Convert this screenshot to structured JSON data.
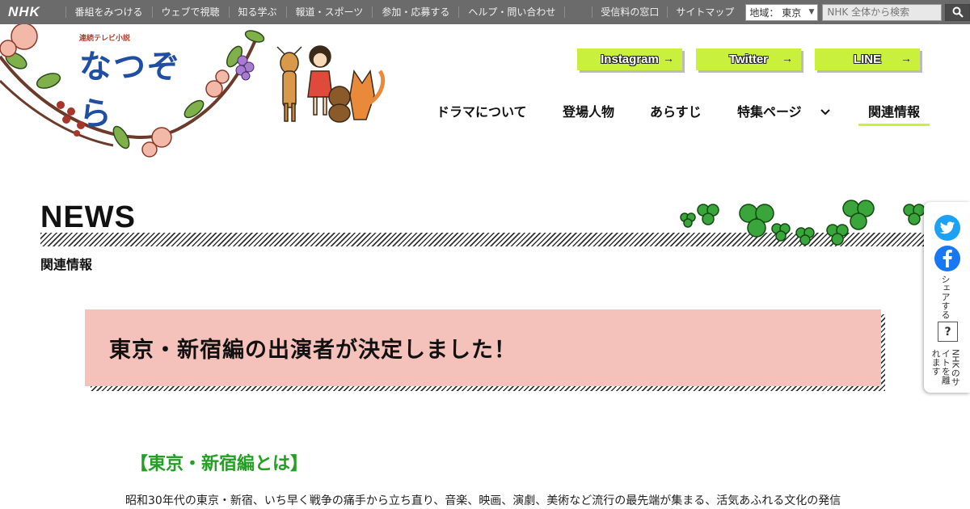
{
  "nhk_bar": {
    "logo": "NHK",
    "links": [
      "番組をみつける",
      "ウェブで視聴",
      "知る学ぶ",
      "報道・スポーツ",
      "参加・応募する",
      "ヘルプ・問い合わせ"
    ],
    "right_links": [
      "受信料の窓口",
      "サイトマップ"
    ],
    "region_select": "地域： 東京",
    "search_placeholder": "NHK 全体から検索"
  },
  "show": {
    "logo_sub": "連続テレビ小説",
    "logo_title": "なつぞら"
  },
  "sns": {
    "instagram": "Instagram",
    "twitter": "Twitter",
    "line": "LINE"
  },
  "main_nav": {
    "items": [
      "ドラマについて",
      "登場人物",
      "あらすじ",
      "特集ページ",
      "関連情報"
    ],
    "active_index": 4
  },
  "news": {
    "title": "NEWS",
    "subtitle": "関連情報"
  },
  "article": {
    "title": "東京・新宿編の出演者が決定しました！",
    "section_heading": "【東京・新宿編とは】",
    "body_first_line": "昭和30年代の東京・新宿、いち早く戦争の痛手から立ち直り、音楽、映画、演劇、美術など流行の最先端が集まる、活気あふれる文化の発信"
  },
  "share_bar": {
    "share_label": "シェアする",
    "help": "?",
    "leave_note": "NHKのサイトを離れます"
  },
  "colors": {
    "nhk_bar": "#6b6b6b",
    "sns_button": "#c8f03c",
    "title_box": "#f5c1bb",
    "section_heading": "#23a023",
    "twitter": "#1da1f2",
    "facebook": "#1877f2"
  }
}
